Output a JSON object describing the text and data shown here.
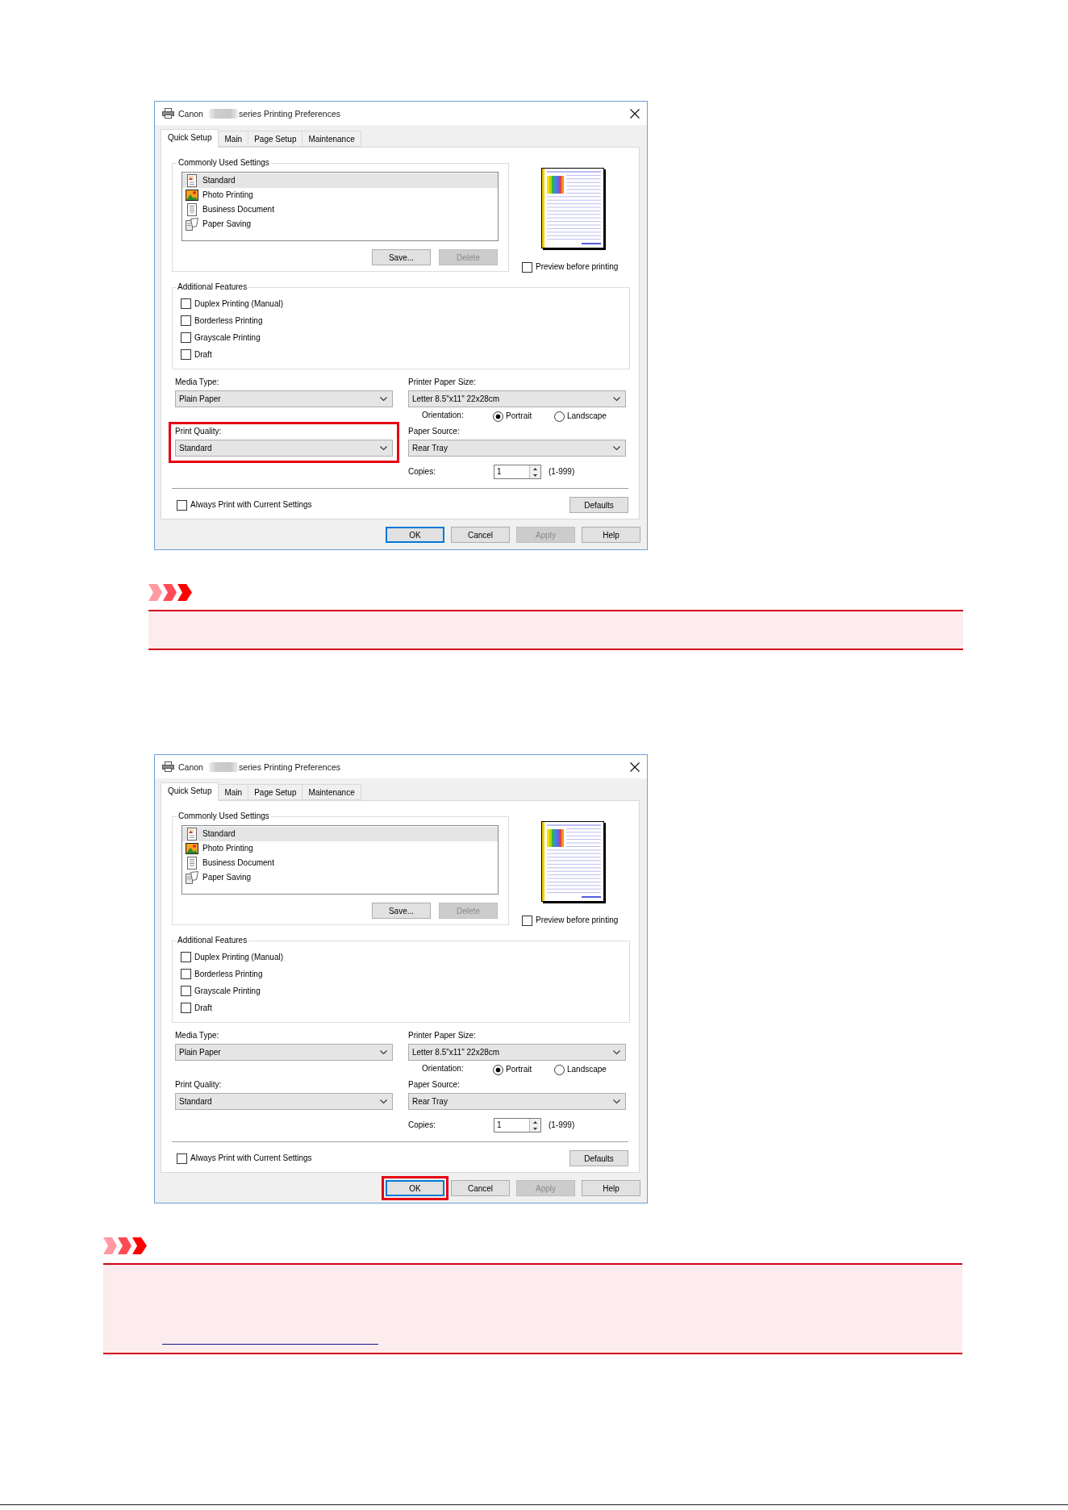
{
  "content": [
    {
      "kind": "dialog",
      "title": {
        "brand": "Canon",
        "rest": "series Printing Preferences"
      },
      "tabs": [
        {
          "label": "Quick Setup",
          "selected": true
        },
        {
          "label": "Main",
          "selected": false
        },
        {
          "label": "Page Setup",
          "selected": false
        },
        {
          "label": "Maintenance",
          "selected": false
        }
      ],
      "commonly_used_settings": {
        "label": "Commonly Used Settings",
        "items": [
          {
            "label": "Standard",
            "selected": true
          },
          {
            "label": "Photo Printing",
            "selected": false
          },
          {
            "label": "Business Document",
            "selected": false
          },
          {
            "label": "Paper Saving",
            "selected": false
          }
        ],
        "buttons": [
          {
            "label": "Save...",
            "disabled": false
          },
          {
            "label": "Delete",
            "disabled": true
          }
        ]
      },
      "preview_before_printing": {
        "label": "Preview before printing",
        "checked": false
      },
      "additional_features": {
        "label": "Additional Features",
        "options": [
          {
            "label": "Duplex Printing (Manual)",
            "checked": false
          },
          {
            "label": "Borderless Printing",
            "checked": false
          },
          {
            "label": "Grayscale Printing",
            "checked": false
          },
          {
            "label": "Draft",
            "checked": false
          }
        ]
      },
      "media_type": {
        "label": "Media Type:",
        "value": "Plain Paper",
        "highlighted": false
      },
      "print_quality": {
        "label": "Print Quality:",
        "value": "Standard",
        "highlighted": true
      },
      "printer_paper_size": {
        "label": "Printer Paper Size:",
        "value": "Letter 8.5\"x11\" 22x28cm",
        "highlighted": false
      },
      "orientation": {
        "label": "Orientation:",
        "options": [
          {
            "label": "Portrait",
            "selected": true
          },
          {
            "label": "Landscape",
            "selected": false
          }
        ]
      },
      "paper_source": {
        "label": "Paper Source:",
        "value": "Rear Tray",
        "highlighted": false
      },
      "copies": {
        "label": "Copies:",
        "value": "1",
        "range": "(1-999)"
      },
      "always_print_with_current_settings": {
        "label": "Always Print with Current Settings",
        "checked": false
      },
      "defaults_button": "Defaults",
      "buttons": [
        {
          "label": "OK",
          "default": true,
          "disabled": false,
          "highlighted": false
        },
        {
          "label": "Cancel",
          "default": false,
          "disabled": false,
          "highlighted": false
        },
        {
          "label": "Apply",
          "default": false,
          "disabled": true,
          "highlighted": false
        },
        {
          "label": "Help",
          "default": false,
          "disabled": false,
          "highlighted": false
        }
      ]
    },
    {
      "kind": "note",
      "indented": true,
      "link": false
    },
    {
      "kind": "dialog",
      "title": {
        "brand": "Canon",
        "rest": "series Printing Preferences"
      },
      "tabs": [
        {
          "label": "Quick Setup",
          "selected": true
        },
        {
          "label": "Main",
          "selected": false
        },
        {
          "label": "Page Setup",
          "selected": false
        },
        {
          "label": "Maintenance",
          "selected": false
        }
      ],
      "commonly_used_settings": {
        "label": "Commonly Used Settings",
        "items": [
          {
            "label": "Standard",
            "selected": true
          },
          {
            "label": "Photo Printing",
            "selected": false
          },
          {
            "label": "Business Document",
            "selected": false
          },
          {
            "label": "Paper Saving",
            "selected": false
          }
        ],
        "buttons": [
          {
            "label": "Save...",
            "disabled": false
          },
          {
            "label": "Delete",
            "disabled": true
          }
        ]
      },
      "preview_before_printing": {
        "label": "Preview before printing",
        "checked": false
      },
      "additional_features": {
        "label": "Additional Features",
        "options": [
          {
            "label": "Duplex Printing (Manual)",
            "checked": false
          },
          {
            "label": "Borderless Printing",
            "checked": false
          },
          {
            "label": "Grayscale Printing",
            "checked": false
          },
          {
            "label": "Draft",
            "checked": false
          }
        ]
      },
      "media_type": {
        "label": "Media Type:",
        "value": "Plain Paper",
        "highlighted": false
      },
      "print_quality": {
        "label": "Print Quality:",
        "value": "Standard",
        "highlighted": false
      },
      "printer_paper_size": {
        "label": "Printer Paper Size:",
        "value": "Letter 8.5\"x11\" 22x28cm",
        "highlighted": false
      },
      "orientation": {
        "label": "Orientation:",
        "options": [
          {
            "label": "Portrait",
            "selected": true
          },
          {
            "label": "Landscape",
            "selected": false
          }
        ]
      },
      "paper_source": {
        "label": "Paper Source:",
        "value": "Rear Tray",
        "highlighted": false
      },
      "copies": {
        "label": "Copies:",
        "value": "1",
        "range": "(1-999)"
      },
      "always_print_with_current_settings": {
        "label": "Always Print with Current Settings",
        "checked": false
      },
      "defaults_button": "Defaults",
      "buttons": [
        {
          "label": "OK",
          "default": true,
          "disabled": false,
          "highlighted": true
        },
        {
          "label": "Cancel",
          "default": false,
          "disabled": false,
          "highlighted": false
        },
        {
          "label": "Apply",
          "default": false,
          "disabled": true,
          "highlighted": false
        },
        {
          "label": "Help",
          "default": false,
          "disabled": false,
          "highlighted": false
        }
      ]
    },
    {
      "kind": "note",
      "indented": false,
      "link": true
    }
  ]
}
